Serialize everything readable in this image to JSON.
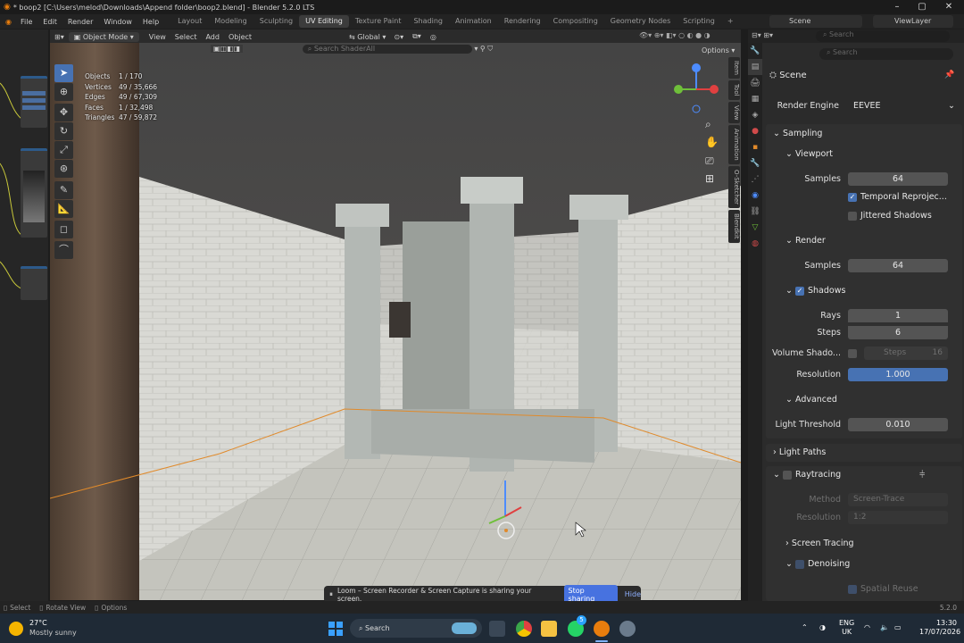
{
  "window": {
    "title": "* boop2 [C:\\Users\\melod\\Downloads\\Append folder\\boop2.blend] - Blender 5.2.0 LTS"
  },
  "menus": [
    "File",
    "Edit",
    "Render",
    "Window",
    "Help"
  ],
  "workspaces": [
    "Layout",
    "Modeling",
    "Sculpting",
    "UV Editing",
    "Texture Paint",
    "Shading",
    "Animation",
    "Rendering",
    "Compositing",
    "Geometry Nodes",
    "Scripting"
  ],
  "workspace_active": "UV Editing",
  "scene_name": "Scene",
  "view_layer": "ViewLayer",
  "viewport_header": {
    "mode": "Object Mode",
    "view": "View",
    "select": "Select",
    "add": "Add",
    "object": "Object",
    "orientation": "Global",
    "options": "Options",
    "search_placeholder": "Search ShaderAll"
  },
  "stats": [
    {
      "key": "Objects",
      "value": "1 / 170"
    },
    {
      "key": "Vertices",
      "value": "49 / 35,666"
    },
    {
      "key": "Edges",
      "value": "49 / 67,309"
    },
    {
      "key": "Faces",
      "value": "1 / 32,498"
    },
    {
      "key": "Triangles",
      "value": "47 / 59,872"
    }
  ],
  "n_panel_tabs": [
    "Item",
    "Tool",
    "View",
    "Animation",
    "O-Sketcher",
    "Blendkit"
  ],
  "properties": {
    "search_placeholder": "Search",
    "context": "Scene",
    "render_engine_label": "Render Engine",
    "render_engine": "EEVEE",
    "sampling": "Sampling",
    "viewport": "Viewport",
    "viewport_samples_label": "Samples",
    "viewport_samples": "64",
    "temporal_reprojection": "Temporal Reprojec...",
    "jittered_shadows": "Jittered Shadows",
    "render": "Render",
    "render_samples_label": "Samples",
    "render_samples": "64",
    "shadows": "Shadows",
    "rays_label": "Rays",
    "rays": "1",
    "steps_label": "Steps",
    "steps": "6",
    "volume_shadows_label": "Volume Shado...",
    "volume_steps_label": "Steps",
    "volume_steps": "16",
    "resolution_label": "Resolution",
    "resolution": "1.000",
    "advanced": "Advanced",
    "light_threshold_label": "Light Threshold",
    "light_threshold": "0.010",
    "light_paths": "Light Paths",
    "raytracing": "Raytracing",
    "method_label": "Method",
    "method": "Screen-Trace",
    "rt_resolution_label": "Resolution",
    "rt_resolution": "1:2",
    "screen_tracing": "Screen Tracing",
    "denoising": "Denoising",
    "spatial_reuse": "Spatial Reuse"
  },
  "statusbar": {
    "select": "Select",
    "rotate_view": "Rotate View",
    "options": "Options",
    "version": "5.2.0"
  },
  "loom": {
    "message": "Loom – Screen Recorder & Screen Capture is sharing your screen.",
    "stop": "Stop sharing",
    "hide": "Hide"
  },
  "taskbar": {
    "temp": "27°C",
    "weather": "Mostly sunny",
    "search_placeholder": "Search",
    "lang": "ENG",
    "region": "UK",
    "time": "13:30",
    "date": "17/07/2026",
    "whatsapp_badge": "5"
  },
  "colors": {
    "accent": "#4772b3",
    "selection": "#e08a2b",
    "taskbar": "#1f2a36"
  }
}
